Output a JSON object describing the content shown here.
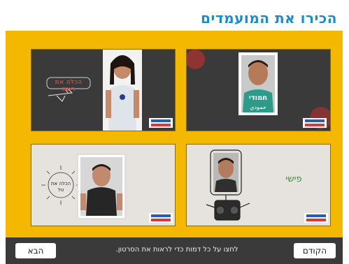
{
  "page": {
    "title": "הכירו את המועמדים"
  },
  "candidates": [
    {
      "name_tag": "הכלה את רונה"
    },
    {
      "name_tag": "חמודי",
      "name_tag_sub": "حمودي"
    },
    {
      "name_tag": "הכלה את טל"
    },
    {
      "name_tag": "פישי"
    }
  ],
  "nav": {
    "next_label": "הבא",
    "prev_label": "הקודם",
    "instruction": "לחצו על כל דמות כדי לראות את הסרטון."
  },
  "colors": {
    "title": "#1b8cc8",
    "stage_background": "#f5b800",
    "nav_background": "#3a3a3a",
    "name_tag_green": "#3a8c2a",
    "name_tag_red": "#d63a3a"
  },
  "icons": [
    "video-logo-icon",
    "clock-icon",
    "airplane-icon",
    "robot-icon"
  ]
}
